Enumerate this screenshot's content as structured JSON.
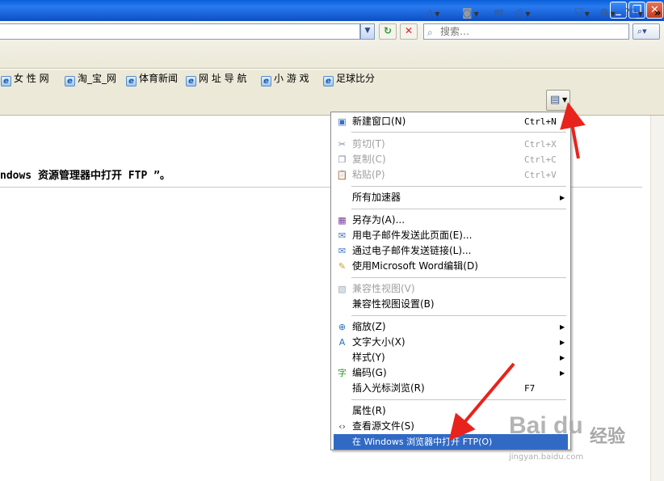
{
  "window": {
    "minimize_glyph": "_",
    "maximize_glyph": "❐",
    "close_glyph": "✕"
  },
  "address_bar": {
    "dropdown_glyph": "▼",
    "refresh_glyph": "↻",
    "stop_glyph": "✕",
    "search_placeholder": "搜索…",
    "search_go_glyph": "⌕▾"
  },
  "favorites": [
    {
      "label": "女 性 网"
    },
    {
      "label": "淘_宝_网"
    },
    {
      "label": "体育新闻"
    },
    {
      "label": "网 址 导 航"
    },
    {
      "label": "小 游 戏"
    },
    {
      "label": "足球比分"
    }
  ],
  "command_bar": {
    "overflow": "»"
  },
  "page": {
    "content_text": "ndows 资源管理器中打开 FTP ”。"
  },
  "menu": {
    "items": [
      {
        "label": "新建窗口(N)",
        "shortcut": "Ctrl+N",
        "icon": "new-window-icon",
        "disabled": false
      },
      {
        "label": "剪切(T)",
        "shortcut": "Ctrl+X",
        "icon": "cut-icon",
        "disabled": true
      },
      {
        "label": "复制(C)",
        "shortcut": "Ctrl+C",
        "icon": "copy-icon",
        "disabled": true
      },
      {
        "label": "粘贴(P)",
        "shortcut": "Ctrl+V",
        "icon": "paste-icon",
        "disabled": true
      },
      {
        "label": "所有加速器",
        "submenu": true
      },
      {
        "label": "另存为(A)...",
        "icon": "save-as-icon"
      },
      {
        "label": "用电子邮件发送此页面(E)...",
        "icon": "email-page-icon"
      },
      {
        "label": "通过电子邮件发送链接(L)...",
        "icon": "email-link-icon"
      },
      {
        "label": "使用Microsoft Word编辑(D)",
        "icon": "word-edit-icon"
      },
      {
        "label": "兼容性视图(V)",
        "icon": "compat-view-icon",
        "disabled": true
      },
      {
        "label": "兼容性视图设置(B)"
      },
      {
        "label": "缩放(Z)",
        "icon": "zoom-icon",
        "submenu": true
      },
      {
        "label": "文字大小(X)",
        "icon": "text-size-icon",
        "submenu": true
      },
      {
        "label": "样式(Y)",
        "submenu": true
      },
      {
        "label": "编码(G)",
        "icon": "encoding-icon",
        "submenu": true
      },
      {
        "label": "插入光标浏览(R)",
        "shortcut": "F7"
      },
      {
        "label": "属性(R)"
      },
      {
        "label": "查看源文件(S)",
        "icon": "view-source-icon"
      },
      {
        "label": "在 Windows 浏览器中打开 FTP(O)",
        "highlighted": true
      }
    ]
  },
  "watermark": {
    "brand": "Bai du",
    "cn": "经验",
    "sub": "jingyan.baidu.com"
  },
  "colors": {
    "highlight": "#316ac5",
    "annotation_arrow": "#e8231c",
    "titlebar": "#1a62d6"
  }
}
